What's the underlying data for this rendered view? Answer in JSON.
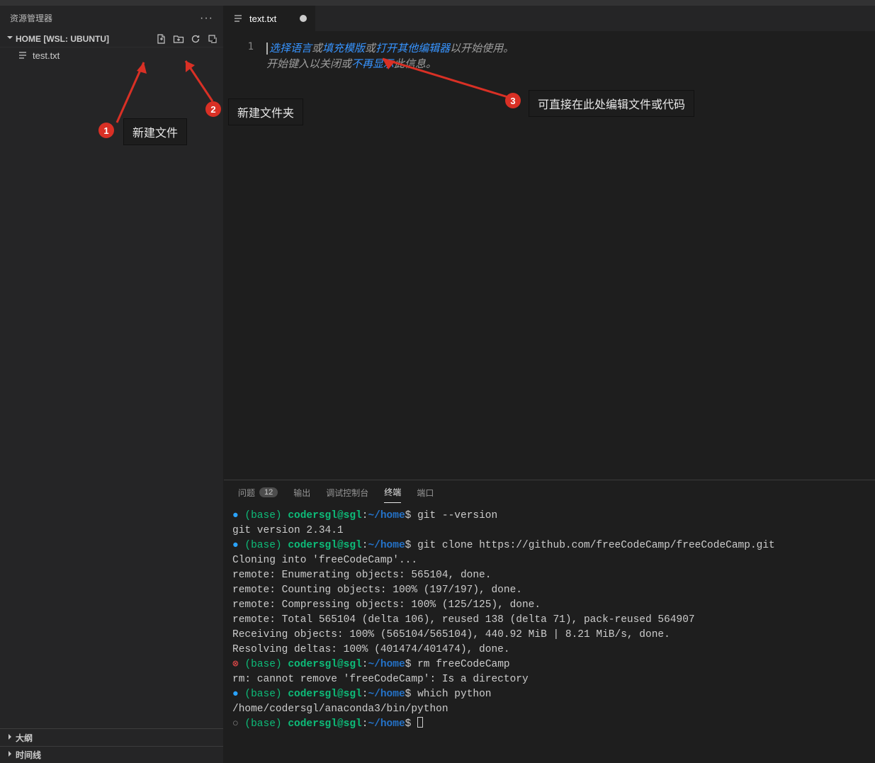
{
  "explorer": {
    "title": "资源管理器",
    "folder": "HOME [WSL: UBUNTU]",
    "file": "test.txt",
    "outline": "大纲",
    "timeline": "时间线"
  },
  "tab": {
    "name": "text.txt"
  },
  "editor": {
    "line_no": "1",
    "line1": {
      "select_lang": "选择语言",
      "or1": "或",
      "fill_template": "填充模版",
      "or2": "或",
      "open_other": "打开其他编辑器",
      "tail": "以开始使用。"
    },
    "line2": {
      "start_typing": "开始键入以关闭或",
      "dont_show": "不再显示",
      "tail": "此信息。"
    }
  },
  "panel": {
    "tabs": {
      "problems": "问题",
      "problems_count": "12",
      "output": "输出",
      "debug": "调试控制台",
      "terminal": "终端",
      "ports": "端口"
    }
  },
  "terminal": {
    "env": "(base) ",
    "user_host": "codersgl@sgl",
    "colon": ":",
    "path": "~/home",
    "dollar": "$ ",
    "lines": [
      {
        "type": "prompt",
        "bullet": "ok",
        "cmd": "git --version"
      },
      {
        "type": "out",
        "text": "git version 2.34.1"
      },
      {
        "type": "prompt",
        "bullet": "ok",
        "cmd": "git clone https://github.com/freeCodeCamp/freeCodeCamp.git"
      },
      {
        "type": "out",
        "text": "Cloning into 'freeCodeCamp'..."
      },
      {
        "type": "out",
        "text": "remote: Enumerating objects: 565104, done."
      },
      {
        "type": "out",
        "text": "remote: Counting objects: 100% (197/197), done."
      },
      {
        "type": "out",
        "text": "remote: Compressing objects: 100% (125/125), done."
      },
      {
        "type": "out",
        "text": "remote: Total 565104 (delta 106), reused 138 (delta 71), pack-reused 564907"
      },
      {
        "type": "out",
        "text": "Receiving objects: 100% (565104/565104), 440.92 MiB | 8.21 MiB/s, done."
      },
      {
        "type": "out",
        "text": "Resolving deltas: 100% (401474/401474), done."
      },
      {
        "type": "prompt",
        "bullet": "err",
        "cmd": "rm freeCodeCamp"
      },
      {
        "type": "out",
        "text": "rm: cannot remove 'freeCodeCamp': Is a directory"
      },
      {
        "type": "prompt",
        "bullet": "ok",
        "cmd": "which python"
      },
      {
        "type": "out",
        "text": "/home/codersgl/anaconda3/bin/python"
      },
      {
        "type": "prompt",
        "bullet": "run",
        "cmd": "",
        "cursor": true
      }
    ]
  },
  "annotations": {
    "n1": "1",
    "n2": "2",
    "n3": "3",
    "label1": "新建文件",
    "label2": "新建文件夹",
    "label3": "可直接在此处编辑文件或代码"
  }
}
